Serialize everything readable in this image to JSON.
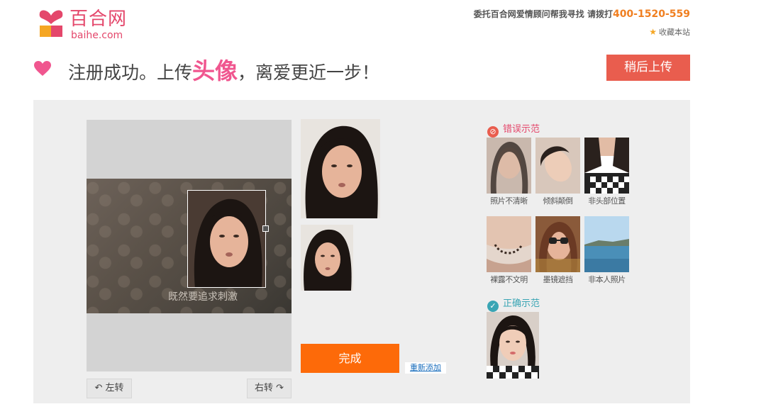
{
  "header": {
    "logo_cn": "百合网",
    "logo_en": "baihe.com",
    "hotline_text": "委托百合网爱情顾问帮我寻找 请拨打",
    "hotline_phone": "400-1520-559",
    "bookmark_label": "收藏本站"
  },
  "banner": {
    "text_before": "注册成功。上传",
    "text_emphasis": "头像",
    "text_after": "，离爱更近一步！",
    "later_button": "稍后上传"
  },
  "editor": {
    "photo_caption": "既然要追求刺激",
    "rotate_left": "左转",
    "rotate_right": "右转",
    "done_button": "完成",
    "re_add_link": "重新添加"
  },
  "examples": {
    "wrong_title": "错误示范",
    "wrong_items": [
      {
        "label": "照片不清晰"
      },
      {
        "label": "倾斜颠倒"
      },
      {
        "label": "非头部位置"
      },
      {
        "label": "裸露不文明"
      },
      {
        "label": "墨镜遮挡"
      },
      {
        "label": "非本人照片"
      }
    ],
    "right_title": "正确示范"
  },
  "colors": {
    "brand_pink": "#e4476b",
    "later_button": "#e95d4e",
    "done_button": "#fd6a09",
    "panel_bg": "#eeeeee",
    "phone_orange": "#f07f20",
    "correct_teal": "#3aa5b4"
  },
  "icons": {
    "logo": "heart-logo-icon",
    "banner": "heart-icon",
    "bookmark": "star-icon",
    "rotate_left": "rotate-left-icon",
    "rotate_right": "rotate-right-icon",
    "wrong": "prohibit-icon",
    "right": "check-icon"
  }
}
